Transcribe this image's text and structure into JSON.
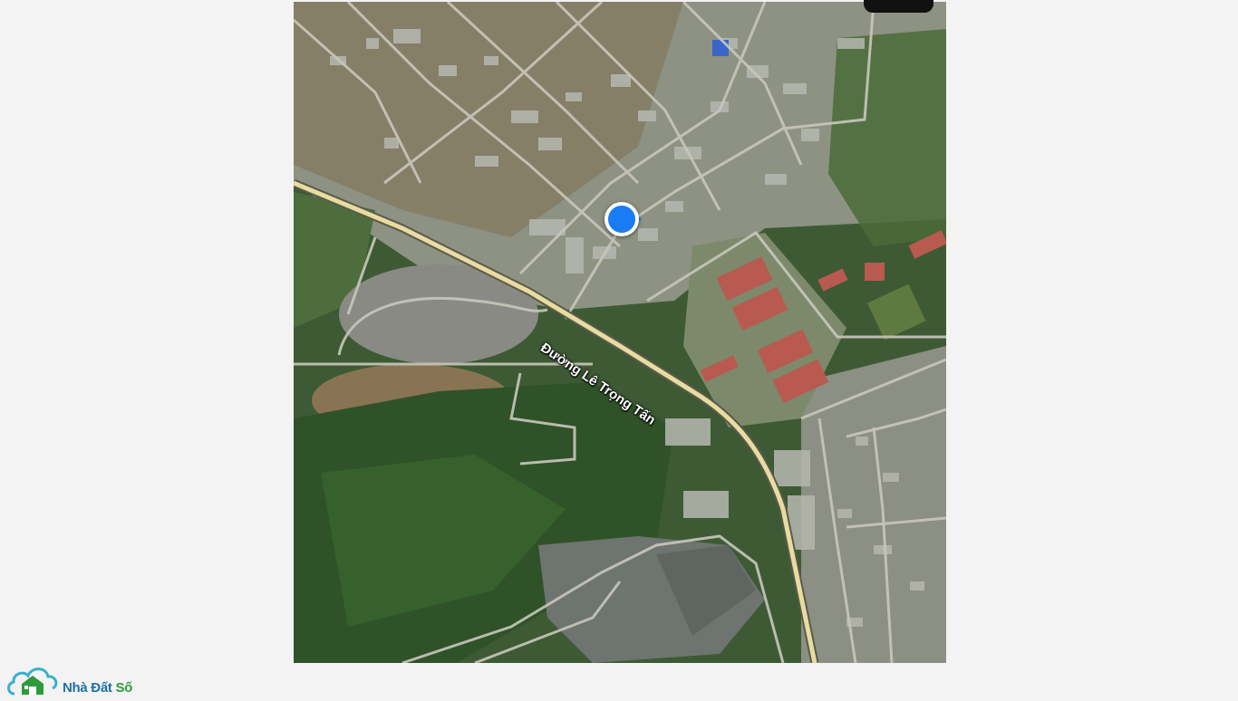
{
  "map": {
    "view": "satellite",
    "road_label": "Đường Lê Trọng Tấn",
    "location_marker": "current-location"
  },
  "brand": {
    "part1": "Nhà Đất ",
    "part2": "Số",
    "icon": "house-cloud-logo"
  },
  "colors": {
    "marker": "#1a7cf5",
    "road_highlight": "#e8dca0",
    "brand_blue": "#1f6fa6",
    "brand_green": "#2f9a3c"
  }
}
